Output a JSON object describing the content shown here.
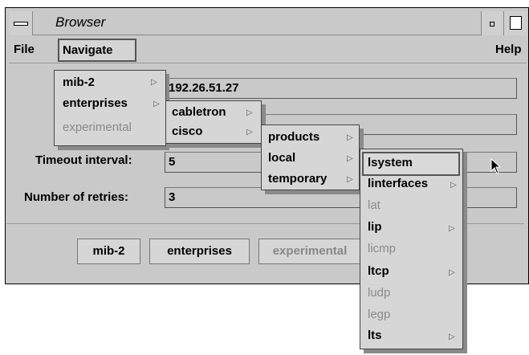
{
  "window": {
    "title": "Browser"
  },
  "menubar": {
    "file": "File",
    "navigate": "Navigate",
    "help": "Help"
  },
  "form": {
    "host_value": "192.26.51.27",
    "community_value": "",
    "timeout_label": "Timeout interval:",
    "timeout_value": "5",
    "retries_label": "Number of retries:",
    "retries_value": "3"
  },
  "buttons": {
    "mib2": "mib-2",
    "enterprises": "enterprises",
    "experimental": "experimental"
  },
  "navigate_menu": {
    "items": [
      "mib-2",
      "enterprises",
      "experimental"
    ]
  },
  "enterprises_menu": {
    "items": [
      "cabletron",
      "cisco"
    ]
  },
  "cisco_menu": {
    "items": [
      "products",
      "local",
      "temporary"
    ]
  },
  "temporary_menu": {
    "items": [
      "lsystem",
      "linterfaces",
      "lat",
      "lip",
      "licmp",
      "ltcp",
      "ludp",
      "legp",
      "lts"
    ]
  },
  "icons": {
    "window_menu": "window-menu-icon",
    "minimize": "minimize-icon",
    "maximize": "maximize-icon",
    "submenu": "submenu-arrow-icon",
    "pointer": "mouse-pointer-icon"
  }
}
